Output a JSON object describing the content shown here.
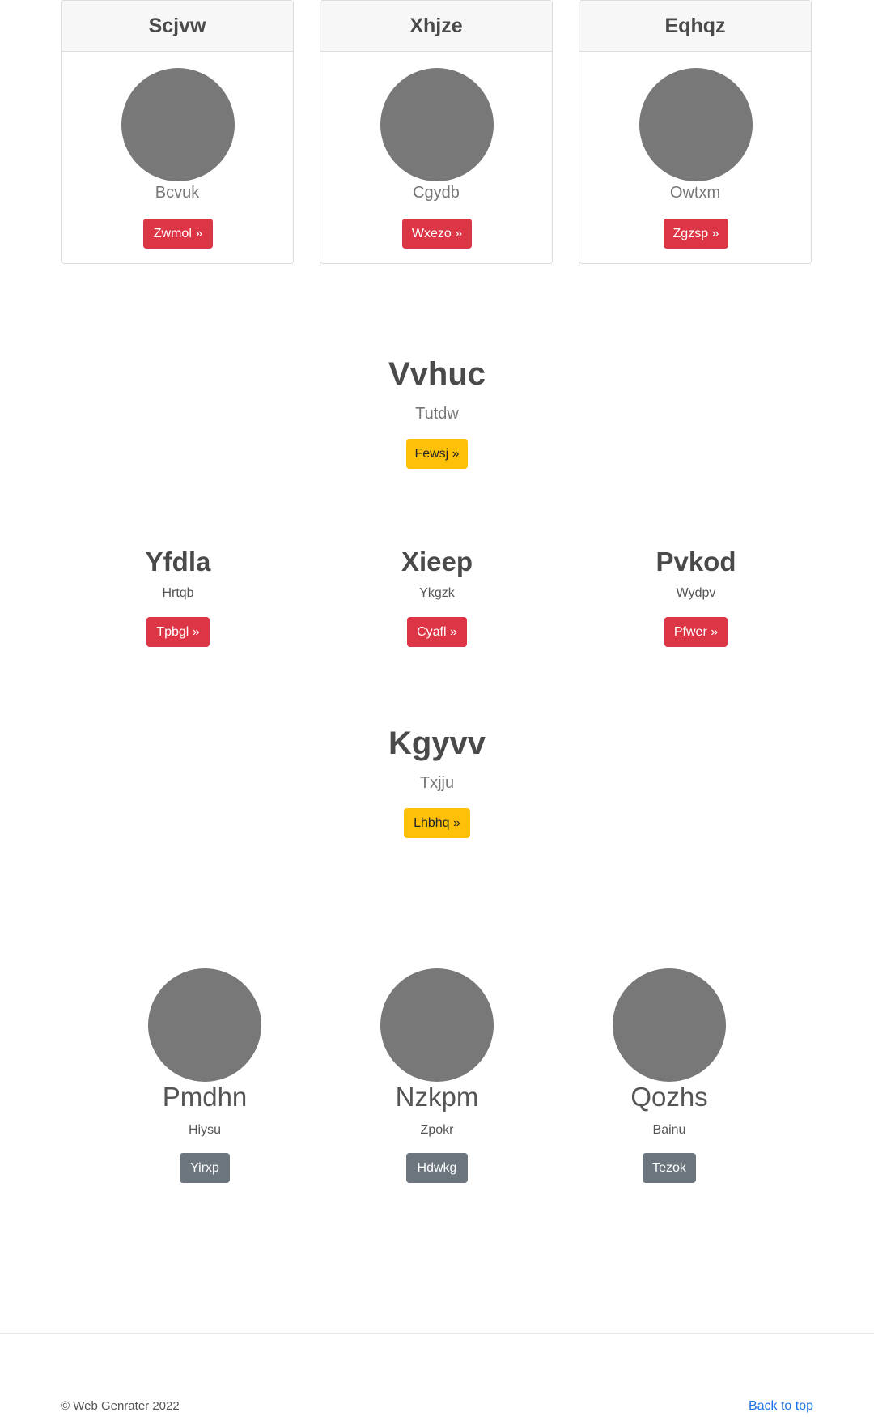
{
  "cards": [
    {
      "title": "Scjvw",
      "text": "Bcvuk",
      "button": "Zwmol »"
    },
    {
      "title": "Xhjze",
      "text": "Cgydb",
      "button": "Wxezo »"
    },
    {
      "title": "Eqhqz",
      "text": "Owtxm",
      "button": "Zgzsp »"
    }
  ],
  "hero1": {
    "title": "Vvhuc",
    "subtitle": "Tutdw",
    "button": "Fewsj »"
  },
  "columns": [
    {
      "title": "Yfdla",
      "text": "Hrtqb",
      "button": "Tpbgl »"
    },
    {
      "title": "Xieep",
      "text": "Ykgzk",
      "button": "Cyafl »"
    },
    {
      "title": "Pvkod",
      "text": "Wydpv",
      "button": "Pfwer »"
    }
  ],
  "hero2": {
    "title": "Kgyvv",
    "subtitle": "Txjju",
    "button": "Lhbhq »"
  },
  "people": [
    {
      "name": "Pmdhn",
      "text": "Hiysu",
      "button": "Yirxp"
    },
    {
      "name": "Nzkpm",
      "text": "Zpokr",
      "button": "Hdwkg"
    },
    {
      "name": "Qozhs",
      "text": "Bainu",
      "button": "Tezok"
    }
  ],
  "footer": {
    "copyright": "© Web Genrater 2022",
    "back_to_top": "Back to top"
  },
  "colors": {
    "danger": "#dc3545",
    "warning": "#ffc107",
    "secondary": "#6c757d",
    "avatar": "#787878",
    "link": "#1a73e8"
  }
}
